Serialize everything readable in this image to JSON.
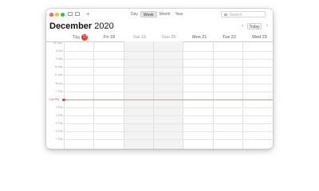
{
  "toolbar": {
    "views": [
      {
        "label": "Day",
        "active": false
      },
      {
        "label": "Week",
        "active": true
      },
      {
        "label": "Month",
        "active": false
      },
      {
        "label": "Year",
        "active": false
      }
    ],
    "search_placeholder": "Search",
    "add_icon": "plus-icon",
    "traffic_light_colors": [
      "#fe5f57",
      "#febc2e",
      "#28c840"
    ]
  },
  "header": {
    "month": "December",
    "year": "2020",
    "prev_icon": "chevron-left-icon",
    "next_icon": "chevron-right-icon",
    "today_label": "Today"
  },
  "days": [
    {
      "label": "Thu",
      "date": "17",
      "today": true
    },
    {
      "label": "Fri 18"
    },
    {
      "label": "Sat 19",
      "weekend": true
    },
    {
      "label": "Sun 20",
      "weekend": true
    },
    {
      "label": "Mon 21"
    },
    {
      "label": "Tue 22"
    },
    {
      "label": "Wed 23"
    }
  ],
  "hours": [
    "All Day",
    "8 AM",
    "9 AM",
    "10 AM",
    "11 AM",
    "Noon",
    "1 PM",
    "",
    "3 PM",
    "4 PM",
    "5 PM",
    "6 PM",
    "7 PM"
  ],
  "current_time": "1:44 PM",
  "accent": "#e8382d"
}
